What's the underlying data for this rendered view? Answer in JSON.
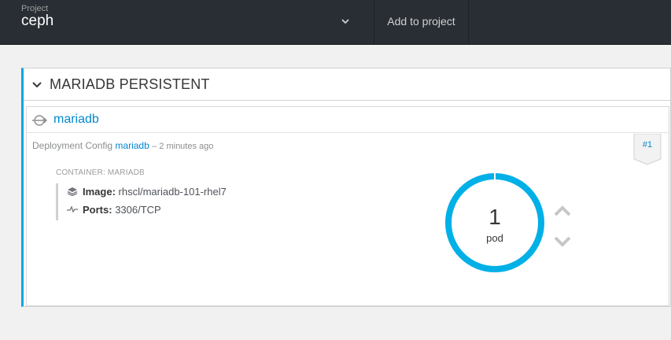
{
  "topbar": {
    "project_caption": "Project",
    "project_name": "ceph",
    "add_to_project": "Add to project"
  },
  "group": {
    "title": "MARIADB PERSISTENT"
  },
  "service": {
    "name": "mariadb"
  },
  "deployment": {
    "prefix": "Deployment Config",
    "config_name": "mariadb",
    "time": "– 2 minutes ago",
    "badge": "#1"
  },
  "container": {
    "heading": "CONTAINER: MARIADB",
    "image_label": "Image:",
    "image_value": "rhscl/mariadb-101-rhel7",
    "ports_label": "Ports:",
    "ports_value": "3306/TCP"
  },
  "pods": {
    "count": "1",
    "label": "pod"
  },
  "colors": {
    "accent": "#00a8e1",
    "link": "#0088ce",
    "topbar": "#292e34"
  }
}
